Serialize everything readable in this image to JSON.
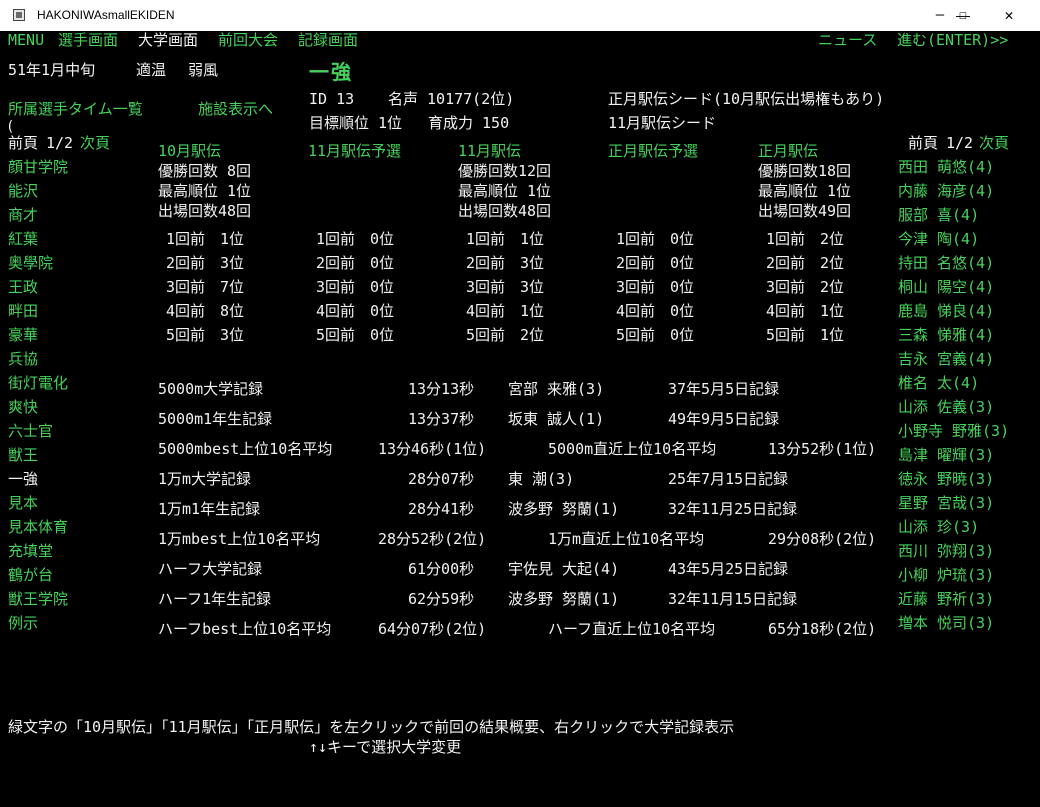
{
  "window": {
    "title": "HAKONIWAsmallEKIDEN",
    "minimize_glyph": "—",
    "maximize_glyph": "☐",
    "close_glyph": "✕"
  },
  "menubar": {
    "items": [
      "MENU",
      "選手画面",
      "大学画面",
      "前回大会",
      "記録画面"
    ],
    "news": "ニュース",
    "advance": "進む(ENTER)>>"
  },
  "status": {
    "date": "51年1月中旬",
    "weather1": "適温",
    "weather2": "弱風"
  },
  "links": {
    "player_times": "所属選手タイム一覧",
    "facilities": "施設表示へ",
    "paren": "("
  },
  "university": {
    "name": "一強",
    "id": "ID 13",
    "fame": "名声 10177(2位)",
    "target": "目標順位 1位",
    "training": "育成力 150",
    "seed1": "正月駅伝シード(10月駅伝出場権もあり)",
    "seed2": "11月駅伝シード"
  },
  "left_list": {
    "pager_prev": "前頁",
    "pager_page": "1/2",
    "pager_next": "次頁",
    "items": [
      {
        "name": "顔甘学院",
        "selected": false
      },
      {
        "name": "能沢",
        "selected": false
      },
      {
        "name": "商才",
        "selected": false
      },
      {
        "name": "紅葉",
        "selected": false
      },
      {
        "name": "奥學院",
        "selected": false
      },
      {
        "name": "王政",
        "selected": false
      },
      {
        "name": "畔田",
        "selected": false
      },
      {
        "name": "豪華",
        "selected": false
      },
      {
        "name": "兵協",
        "selected": false
      },
      {
        "name": "街灯電化",
        "selected": false
      },
      {
        "name": "爽快",
        "selected": false
      },
      {
        "name": "六士官",
        "selected": false
      },
      {
        "name": "獣王",
        "selected": false
      },
      {
        "name": "一強",
        "selected": true
      },
      {
        "name": "見本",
        "selected": false
      },
      {
        "name": "見本体育",
        "selected": false
      },
      {
        "name": "充填堂",
        "selected": false
      },
      {
        "name": "鶴が台",
        "selected": false
      },
      {
        "name": "獣王学院",
        "selected": false
      },
      {
        "name": "例示",
        "selected": false
      }
    ]
  },
  "races": [
    {
      "title": "10月駅伝",
      "wins": "優勝回数 8回",
      "best": "最高順位 1位",
      "entries": "出場回数48回",
      "history": [
        "1回前　1位",
        "2回前　3位",
        "3回前　7位",
        "4回前　8位",
        "5回前　3位"
      ]
    },
    {
      "title": "11月駅伝予選",
      "wins": "",
      "best": "",
      "entries": "",
      "history": [
        "1回前　0位",
        "2回前　0位",
        "3回前　0位",
        "4回前　0位",
        "5回前　0位"
      ]
    },
    {
      "title": "11月駅伝",
      "wins": "優勝回数12回",
      "best": "最高順位 1位",
      "entries": "出場回数48回",
      "history": [
        "1回前　1位",
        "2回前　3位",
        "3回前　3位",
        "4回前　1位",
        "5回前　2位"
      ]
    },
    {
      "title": "正月駅伝予選",
      "wins": "",
      "best": "",
      "entries": "",
      "history": [
        "1回前　0位",
        "2回前　0位",
        "3回前　0位",
        "4回前　0位",
        "5回前　0位"
      ]
    },
    {
      "title": "正月駅伝",
      "wins": "優勝回数18回",
      "best": "最高順位 1位",
      "entries": "出場回数49回",
      "history": [
        "1回前　2位",
        "2回前　2位",
        "3回前　2位",
        "4回前　1位",
        "5回前　1位"
      ]
    }
  ],
  "records": [
    {
      "label": "5000m大学記録",
      "time": "13分13秒",
      "runner": "宮部 来雅(3)",
      "date": "37年5月5日記録"
    },
    {
      "label": "5000m1年生記録",
      "time": "13分37秒",
      "runner": "坂東 誠人(1)",
      "date": "49年9月5日記録"
    },
    {
      "label": "5000mbest上位10名平均",
      "time": "13分46秒(1位)",
      "label2": "5000m直近上位10名平均",
      "time2": "13分52秒(1位)"
    },
    {
      "label": "1万m大学記録",
      "time": "28分07秒",
      "runner": "東 潮(3)",
      "date": "25年7月15日記録"
    },
    {
      "label": "1万m1年生記録",
      "time": "28分41秒",
      "runner": "波多野 努蘭(1)",
      "date": "32年11月25日記録"
    },
    {
      "label": "1万mbest上位10名平均",
      "time": "28分52秒(2位)",
      "label2": "1万m直近上位10名平均",
      "time2": "29分08秒(2位)"
    },
    {
      "label": "ハーフ大学記録",
      "time": "61分00秒",
      "runner": "宇佐見 大起(4)",
      "date": "43年5月25日記録"
    },
    {
      "label": "ハーフ1年生記録",
      "time": "62分59秒",
      "runner": "波多野 努蘭(1)",
      "date": "32年11月15日記録"
    },
    {
      "label": "ハーフbest上位10名平均",
      "time": "64分07秒(2位)",
      "label2": "ハーフ直近上位10名平均",
      "time2": "65分18秒(2位)"
    }
  ],
  "right_list": {
    "pager_prev": "前頁",
    "pager_page": "1/2",
    "pager_next": "次頁",
    "players": [
      "西田 萌悠(4)",
      "内藤 海彦(4)",
      "服部 喜(4)",
      "今津 陶(4)",
      "持田 名悠(4)",
      "桐山 陽空(4)",
      "鹿島 悌良(4)",
      "三森 悌雅(4)",
      "吉永 宮義(4)",
      "椎名 太(4)",
      "山添 佐義(3)",
      "小野寺 野雅(3)",
      "島津 曜輝(3)",
      "徳永 野暁(3)",
      "星野 宮哉(3)",
      "山添 珍(3)",
      "西川 弥翔(3)",
      "小柳 炉琉(3)",
      "近藤 野祈(3)",
      "増本 悦司(3)"
    ]
  },
  "footer": {
    "line1": "緑文字の「10月駅伝」「11月駅伝」「正月駅伝」を左クリックで前回の結果概要、右クリックで大学記録表示",
    "line2": "↑↓キーで選択大学変更"
  }
}
